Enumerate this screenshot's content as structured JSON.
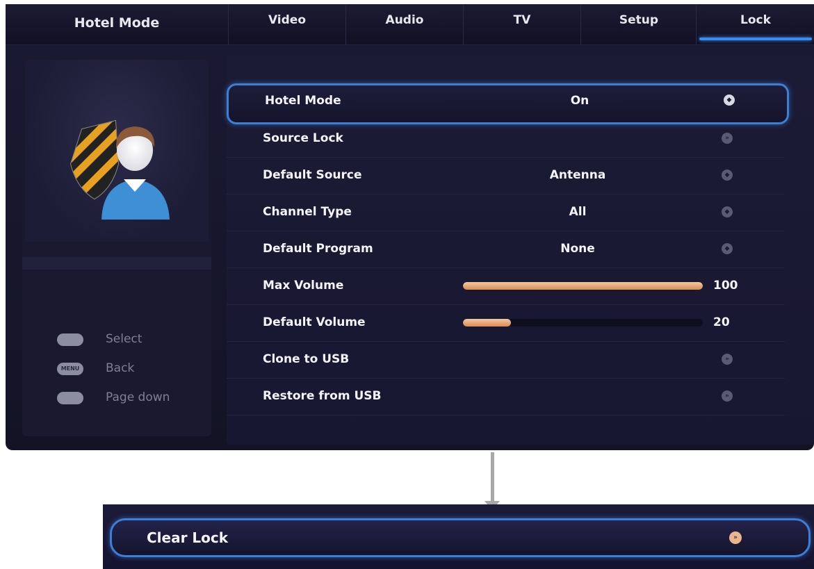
{
  "colors": {
    "accent": "#3d7fd6",
    "slider_fill": "#d98c55",
    "background": "#171630"
  },
  "nav": {
    "title": "Hotel Mode",
    "tabs": [
      {
        "label": "Video"
      },
      {
        "label": "Audio"
      },
      {
        "label": "TV"
      },
      {
        "label": "Setup"
      },
      {
        "label": "Lock",
        "active": true
      }
    ]
  },
  "left": {
    "avatar_icon": "shield-user-icon",
    "hints": [
      {
        "icon": "dpad-icon",
        "key": "",
        "label": "Select"
      },
      {
        "icon": "menu-key-icon",
        "key": "MENU",
        "label": "Back"
      },
      {
        "icon": "updown-icon",
        "key": "",
        "label": "Page down"
      }
    ]
  },
  "menu": {
    "rows": [
      {
        "label": "Hotel Mode",
        "value": "On",
        "icon": "toggle-icon",
        "selected": true
      },
      {
        "label": "Source Lock",
        "value": "",
        "icon": "chevron-right-icon"
      },
      {
        "label": "Default Source",
        "value": "Antenna",
        "icon": "toggle-icon"
      },
      {
        "label": "Channel Type",
        "value": "All",
        "icon": "toggle-icon"
      },
      {
        "label": "Default Program",
        "value": "None",
        "icon": "toggle-icon"
      },
      {
        "label": "Max Volume",
        "slider": 100,
        "max": 100,
        "number": "100"
      },
      {
        "label": "Default Volume",
        "slider": 20,
        "max": 100,
        "number": "20"
      },
      {
        "label": "Clone to USB",
        "value": "",
        "icon": "chevron-right-icon"
      },
      {
        "label": "Restore from USB",
        "value": "",
        "icon": "chevron-right-icon"
      }
    ]
  },
  "bottom": {
    "clear_lock": {
      "label": "Clear Lock",
      "icon": "chevron-right-icon"
    }
  }
}
